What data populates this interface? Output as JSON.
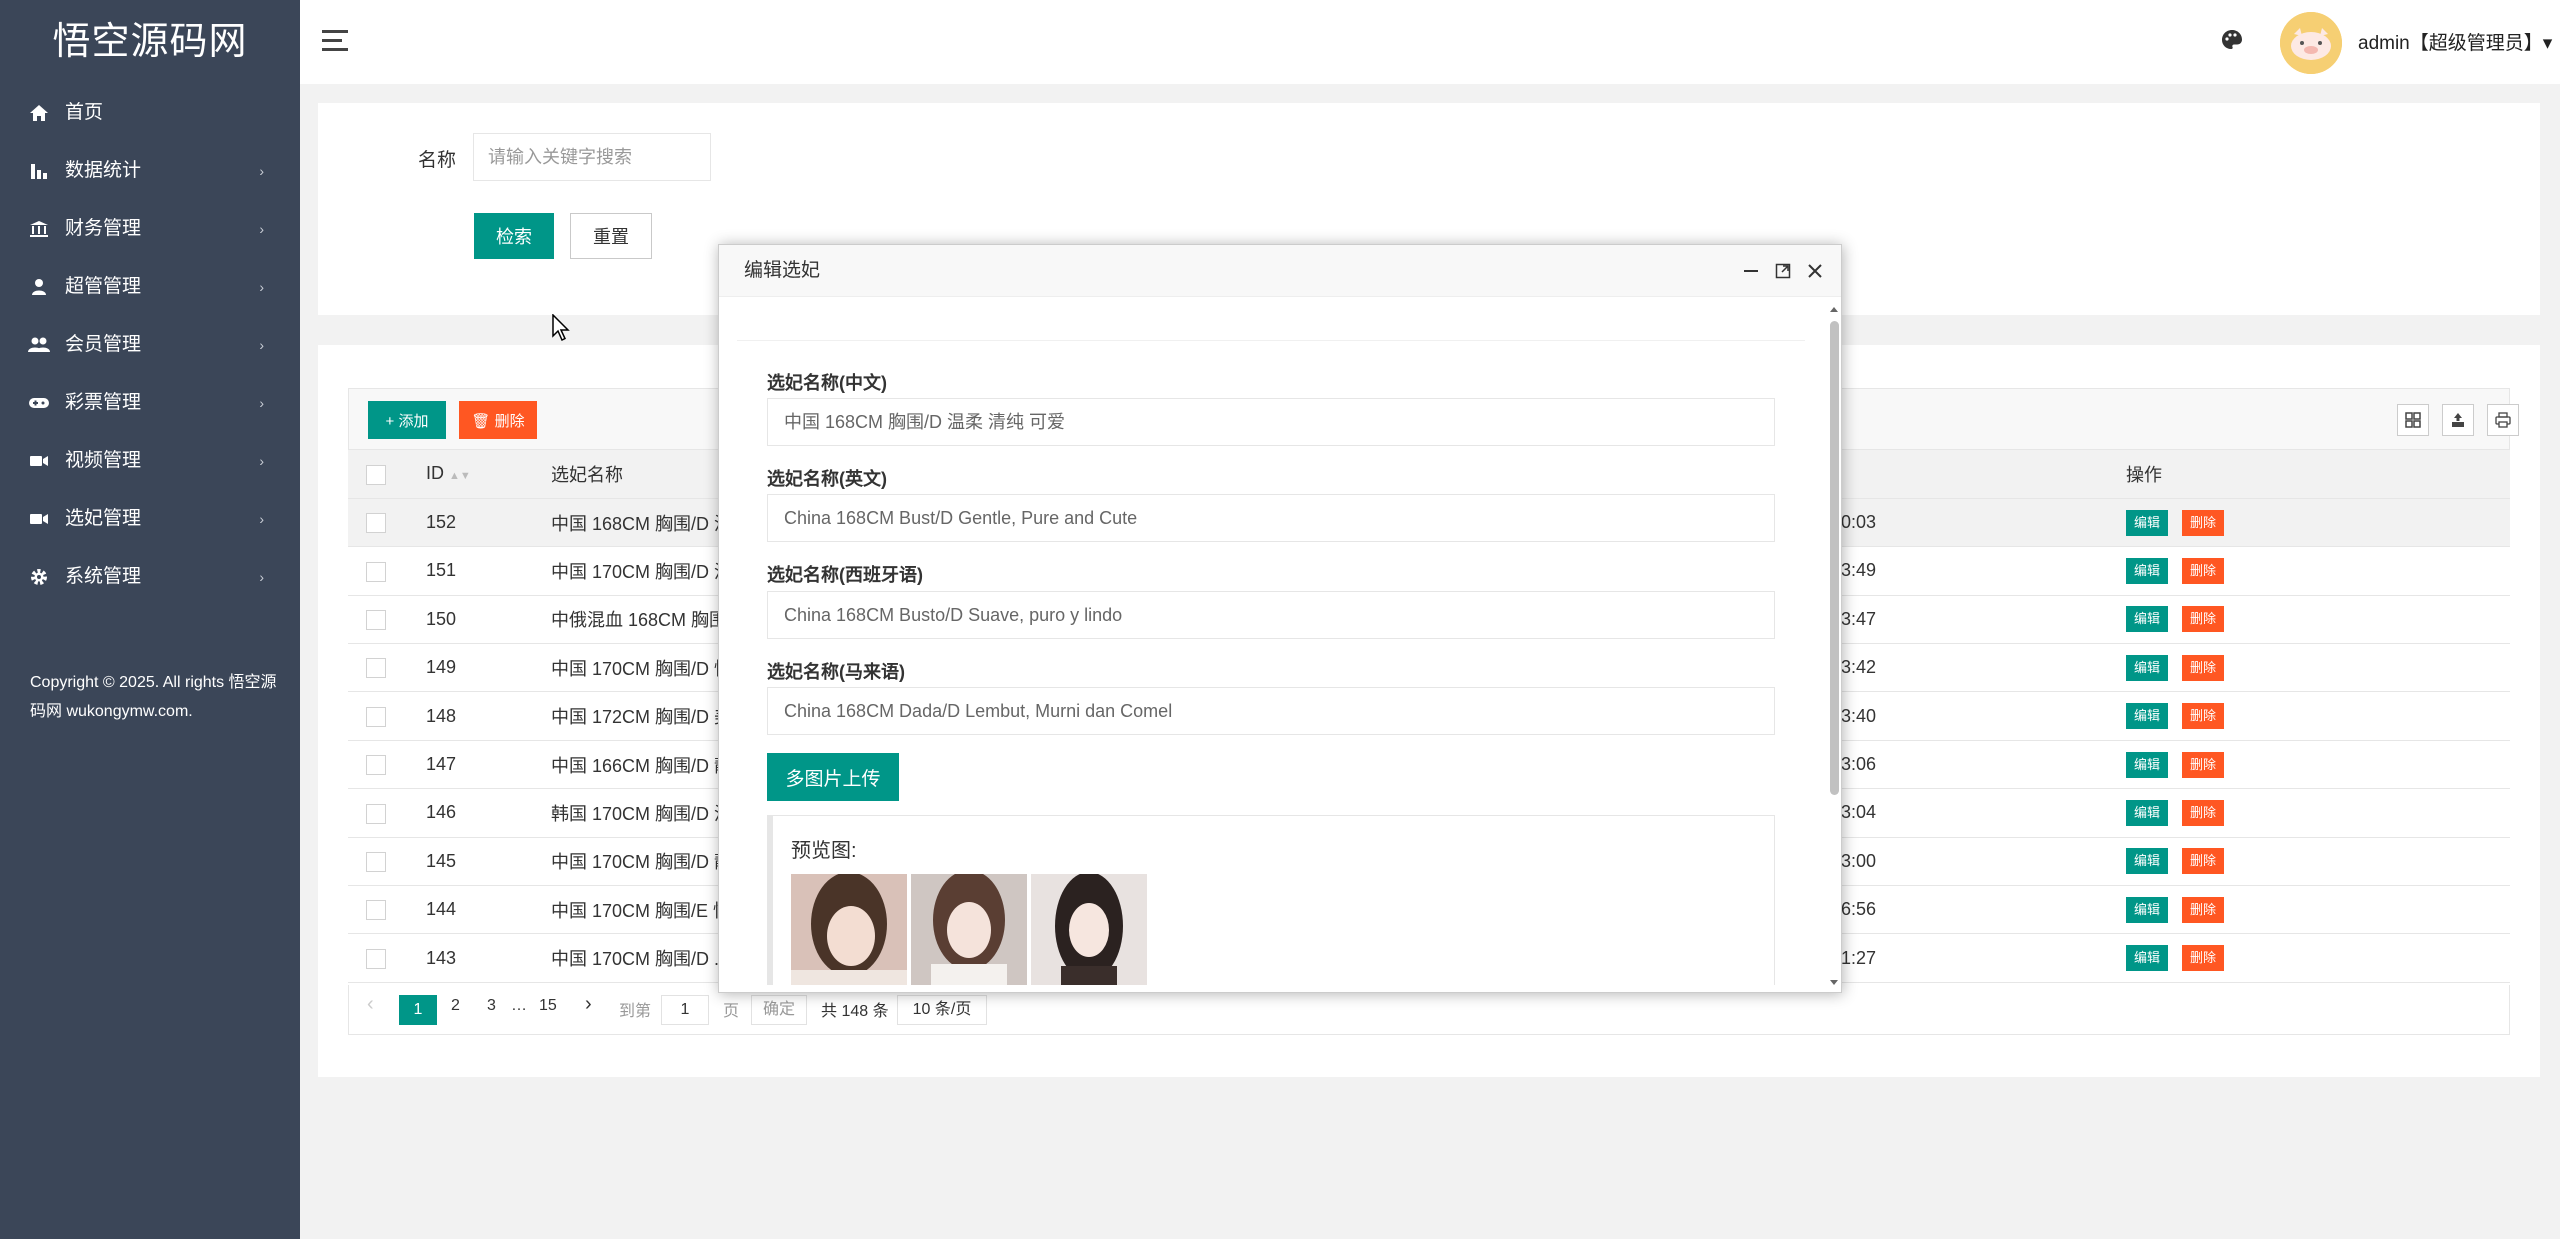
{
  "sidebar": {
    "logo": "悟空源码网",
    "items": [
      {
        "label": "首页",
        "icon": "home-icon"
      },
      {
        "label": "数据统计",
        "icon": "bar-chart-icon",
        "arrow": "›"
      },
      {
        "label": "财务管理",
        "icon": "bank-icon",
        "arrow": "›"
      },
      {
        "label": "超管管理",
        "icon": "user-icon",
        "arrow": "›"
      },
      {
        "label": "会员管理",
        "icon": "users-icon",
        "arrow": "›"
      },
      {
        "label": "彩票管理",
        "icon": "gamepad-icon",
        "arrow": "›"
      },
      {
        "label": "视频管理",
        "icon": "video-icon",
        "arrow": "›"
      },
      {
        "label": "选妃管理",
        "icon": "video-icon",
        "arrow": "›"
      },
      {
        "label": "系统管理",
        "icon": "gear-icon",
        "arrow": "›"
      }
    ],
    "copyright": "Copyright © 2025. All rights 悟空源码网 wukongymw.com."
  },
  "header": {
    "user": "admin【超级管理员】▾"
  },
  "search": {
    "label": "名称",
    "placeholder": "请输入关键字搜索",
    "search_btn": "检索",
    "reset_btn": "重置"
  },
  "toolbar": {
    "add": "+ 添加",
    "delete": "🗑 删除"
  },
  "table": {
    "headers": {
      "id": "ID",
      "name": "选妃名称",
      "time": "",
      "op": "操作"
    },
    "edit_label": "编辑",
    "delete_label": "删除",
    "rows": [
      {
        "id": "152",
        "name": "中国 168CM 胸围/D 温",
        "time": "0:03"
      },
      {
        "id": "151",
        "name": "中国 170CM 胸围/D 温",
        "time": "3:49"
      },
      {
        "id": "150",
        "name": "中俄混血 168CM 胸围",
        "time": "3:47"
      },
      {
        "id": "149",
        "name": "中国 170CM 胸围/D 性",
        "time": "3:42"
      },
      {
        "id": "148",
        "name": "中国 172CM 胸围/D 美",
        "time": "3:40"
      },
      {
        "id": "147",
        "name": "中国 166CM 胸围/D 靓",
        "time": "3:06"
      },
      {
        "id": "146",
        "name": "韩国 170CM 胸围/D 温",
        "time": "3:04"
      },
      {
        "id": "145",
        "name": "中国 170CM 胸围/D 靓",
        "time": "3:00"
      },
      {
        "id": "144",
        "name": "中国 170CM 胸围/E 性",
        "time": "6:56"
      },
      {
        "id": "143",
        "name": "中国 170CM 胸围/D .",
        "time": "1:27"
      }
    ]
  },
  "pager": {
    "prev": "‹",
    "p1": "1",
    "p2": "2",
    "p3": "3",
    "ellipsis": "…",
    "p15": "15",
    "next": "›",
    "goto": "到第",
    "goto_value": "1",
    "page_unit": "页",
    "confirm": "确定",
    "total": "共 148 条",
    "per_page": "10 条/页"
  },
  "modal": {
    "title": "编辑选妃",
    "fields": [
      {
        "label": "选妃名称(中文)",
        "value": "中国   168CM  胸围/D   温柔  清纯  可爱"
      },
      {
        "label": "选妃名称(英文)",
        "value": "China 168CM Bust/D Gentle, Pure and Cute"
      },
      {
        "label": "选妃名称(西班牙语)",
        "value": "China 168CM Busto/D Suave, puro y lindo"
      },
      {
        "label": "选妃名称(马来语)",
        "value": "China 168CM Dada/D Lembut, Murni dan Comel"
      }
    ],
    "upload_btn": "多图片上传",
    "preview_label": "预览图:"
  },
  "colors": {
    "sidebar_bg": "#3b4658",
    "primary": "#009688",
    "danger": "#ff5722"
  }
}
